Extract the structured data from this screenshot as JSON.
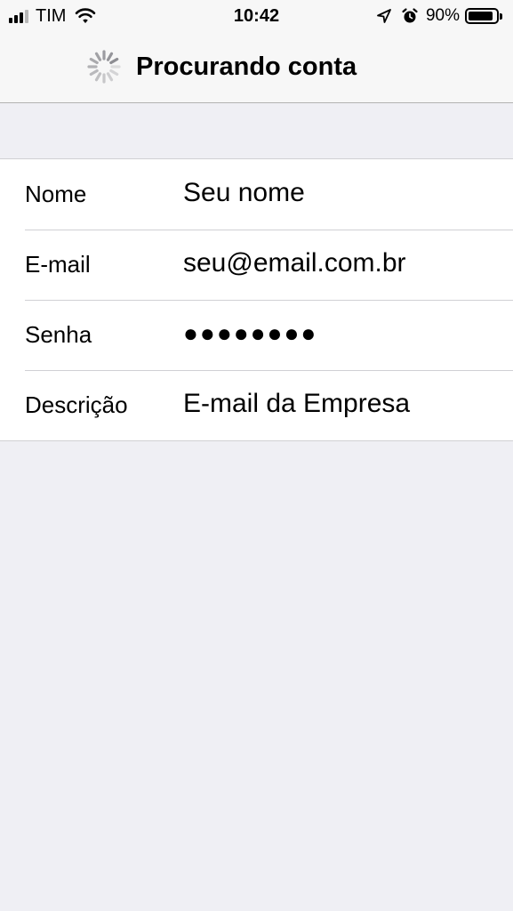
{
  "status_bar": {
    "carrier": "TIM",
    "time": "10:42",
    "battery_percent": "90%",
    "battery_level": 0.9,
    "signal_bars_active": 3,
    "signal_bars_total": 4,
    "icons": [
      "signal-icon",
      "wifi-icon",
      "location-arrow-icon",
      "alarm-icon",
      "battery-icon"
    ]
  },
  "nav": {
    "title": "Procurando conta",
    "spinner_icon": "activity-spinner-icon"
  },
  "form": {
    "rows": [
      {
        "label": "Nome",
        "value": "Seu nome"
      },
      {
        "label": "E-mail",
        "value": "seu@email.com.br"
      },
      {
        "label": "Senha",
        "value": "●●●●●●●●"
      },
      {
        "label": "Descrição",
        "value": "E-mail da Empresa"
      }
    ]
  },
  "colors": {
    "background": "#efeff4",
    "bar_background": "#f7f7f7",
    "cell_background": "#ffffff",
    "separator": "#d0d0d4",
    "text": "#000000"
  }
}
